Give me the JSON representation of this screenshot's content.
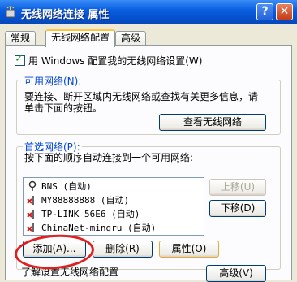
{
  "window": {
    "title": "无线网络连接 属性",
    "help_label": "?",
    "close_label": "✕"
  },
  "tabs": [
    {
      "label": "常规"
    },
    {
      "label": "无线网络配置"
    },
    {
      "label": "高级"
    }
  ],
  "use_windows_checkbox": {
    "label": "用 Windows 配置我的无线网络设置(W)",
    "checked": true
  },
  "available_networks": {
    "title": "可用网络(N):",
    "desc_line1": "要连接、断开区域内无线网络或查找有关更多信息，请",
    "desc_line2": "单击下面的按钮。",
    "view_button": "查看无线网络"
  },
  "preferred_networks": {
    "title": "首选网络(P):",
    "desc": "按下面的顺序自动连接到一个可用网络:",
    "items": [
      {
        "label": "BNS (自动)",
        "icon": "wireless-antenna-icon"
      },
      {
        "label": "MY88888888 (自动)",
        "icon": "wireless-x-icon"
      },
      {
        "label": "TP-LINK_56E6 (自动)",
        "icon": "wireless-x-icon"
      },
      {
        "label": "ChinaNet-mingru (自动)",
        "icon": "wireless-x-icon"
      }
    ],
    "move_up": "上移(U)",
    "move_down": "下移(D)",
    "add": "添加(A)...",
    "remove": "删除(R)",
    "properties": "属性(O)"
  },
  "footer": {
    "link_text": "了解设置无线网络配置",
    "advanced_button": "高级(V)"
  },
  "colors": {
    "title_bar": "#0a5fe0",
    "group_title": "#0046d5",
    "annotation_circle": "#e02020"
  }
}
